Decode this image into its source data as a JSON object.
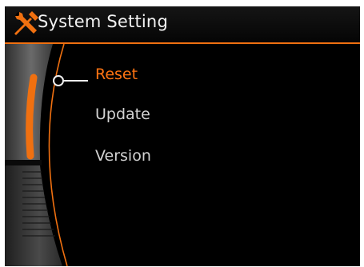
{
  "header": {
    "title": "System Setting",
    "icon": "tools-icon"
  },
  "menu": {
    "items": [
      {
        "label": "Reset",
        "selected": true
      },
      {
        "label": "Update",
        "selected": false
      },
      {
        "label": "Version",
        "selected": false
      }
    ]
  },
  "colors": {
    "accent": "#f07010",
    "selected_text": "#ff7412",
    "text": "#d3d3d3",
    "background": "#000000",
    "knob": "#555555"
  },
  "scroll": {
    "position": 0
  }
}
